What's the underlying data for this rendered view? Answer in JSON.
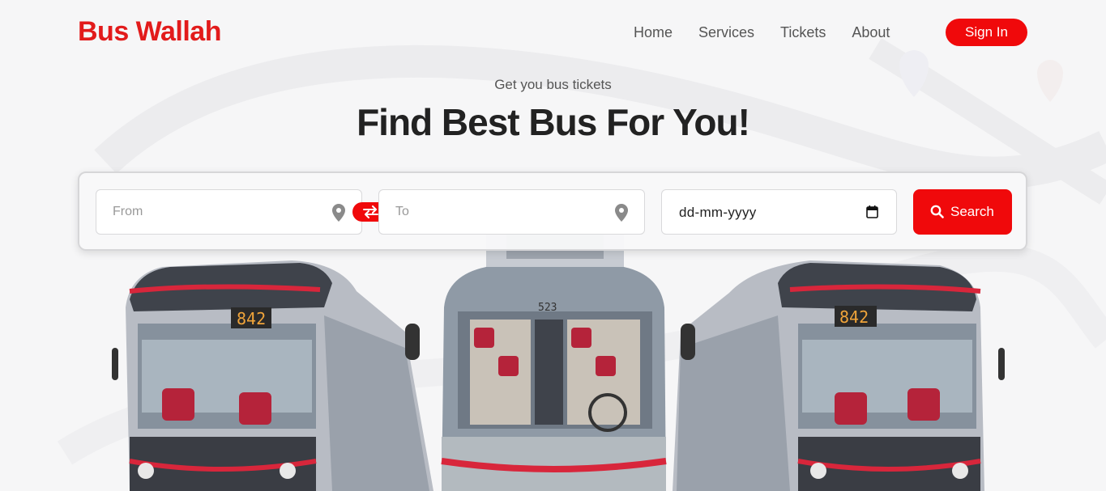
{
  "brand": {
    "name": "Bus Wallah",
    "color": "#e21b1b"
  },
  "nav": {
    "links": [
      {
        "label": "Home"
      },
      {
        "label": "Services"
      },
      {
        "label": "Tickets"
      },
      {
        "label": "About"
      }
    ],
    "signin_label": "Sign In"
  },
  "hero": {
    "subtitle": "Get you bus tickets",
    "title": "Find Best Bus For You!"
  },
  "search": {
    "from_placeholder": "From",
    "to_placeholder": "To",
    "date_placeholder": "dd-mm-yyyy",
    "button_label": "Search",
    "icons": {
      "location": "map-pin-icon",
      "swap": "swap-arrows-icon",
      "calendar": "calendar-icon",
      "search": "magnifier-icon"
    }
  },
  "buses": {
    "left_route": "842",
    "center_route": "523",
    "right_route": "842"
  },
  "colors": {
    "accent": "#f0090b",
    "background": "#f6f6f7"
  }
}
